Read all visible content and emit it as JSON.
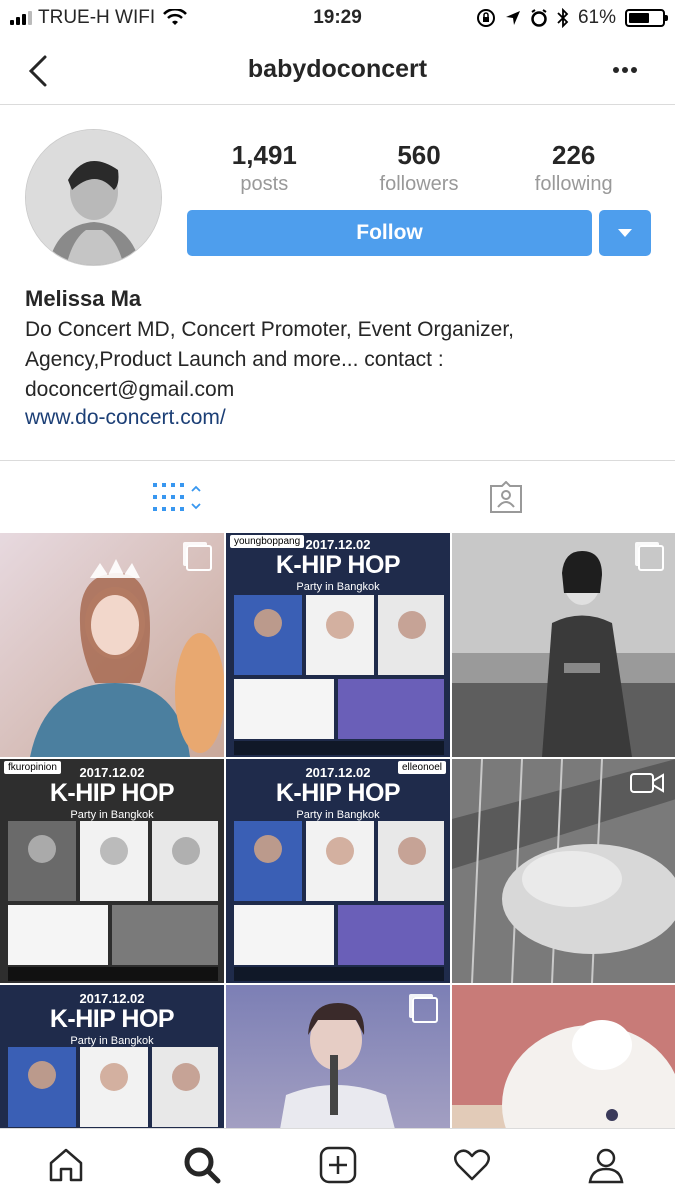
{
  "status": {
    "carrier": "TRUE-H WIFI",
    "time": "19:29",
    "battery": "61%",
    "battery_level": 0.61
  },
  "nav": {
    "title": "babydoconcert",
    "back_icon": "chevron-left-icon",
    "more_icon": "more-dots-icon"
  },
  "profile": {
    "stats": [
      {
        "value": "1,491",
        "label": "posts"
      },
      {
        "value": "560",
        "label": "followers"
      },
      {
        "value": "226",
        "label": "following"
      }
    ],
    "follow_label": "Follow",
    "name": "Melissa Ma",
    "bio": "Do Concert MD, Concert Promoter, Event Organizer, Agency,Product Launch and more... contact : doconcert@gmail.com",
    "link": "www.do-concert.com/"
  },
  "tabs": [
    {
      "icon": "grid-view-icon",
      "active": true
    },
    {
      "icon": "tagged-photos-icon",
      "active": false
    }
  ],
  "posts": [
    {
      "id": "post-1",
      "kind": "photo",
      "overlay": "multi-icon"
    },
    {
      "id": "post-2",
      "kind": "poster",
      "repost_user": "youngboppang",
      "date": "2017.12.02",
      "headline": "K-HIP HOP",
      "subtitle": "Party in Bangkok"
    },
    {
      "id": "post-3",
      "kind": "photo",
      "overlay": "multi-icon"
    },
    {
      "id": "post-4",
      "kind": "poster",
      "repost_user": "fkuropinion",
      "date": "2017.12.02",
      "headline": "K-HIP HOP",
      "subtitle": "Party in Bangkok"
    },
    {
      "id": "post-5",
      "kind": "poster",
      "repost_user": "elleonoel",
      "date": "2017.12.02",
      "headline": "K-HIP HOP",
      "subtitle": "Party in Bangkok"
    },
    {
      "id": "post-6",
      "kind": "video",
      "overlay": "video-icon"
    },
    {
      "id": "post-7",
      "kind": "poster",
      "date": "2017.12.02",
      "headline": "K-HIP HOP",
      "subtitle": "Party in Bangkok"
    },
    {
      "id": "post-8",
      "kind": "photo",
      "overlay": "multi-icon"
    },
    {
      "id": "post-9",
      "kind": "photo"
    }
  ],
  "bottom_nav": [
    {
      "icon": "home-icon"
    },
    {
      "icon": "search-icon",
      "active": true
    },
    {
      "icon": "add-post-icon"
    },
    {
      "icon": "heart-icon"
    },
    {
      "icon": "profile-icon"
    }
  ]
}
